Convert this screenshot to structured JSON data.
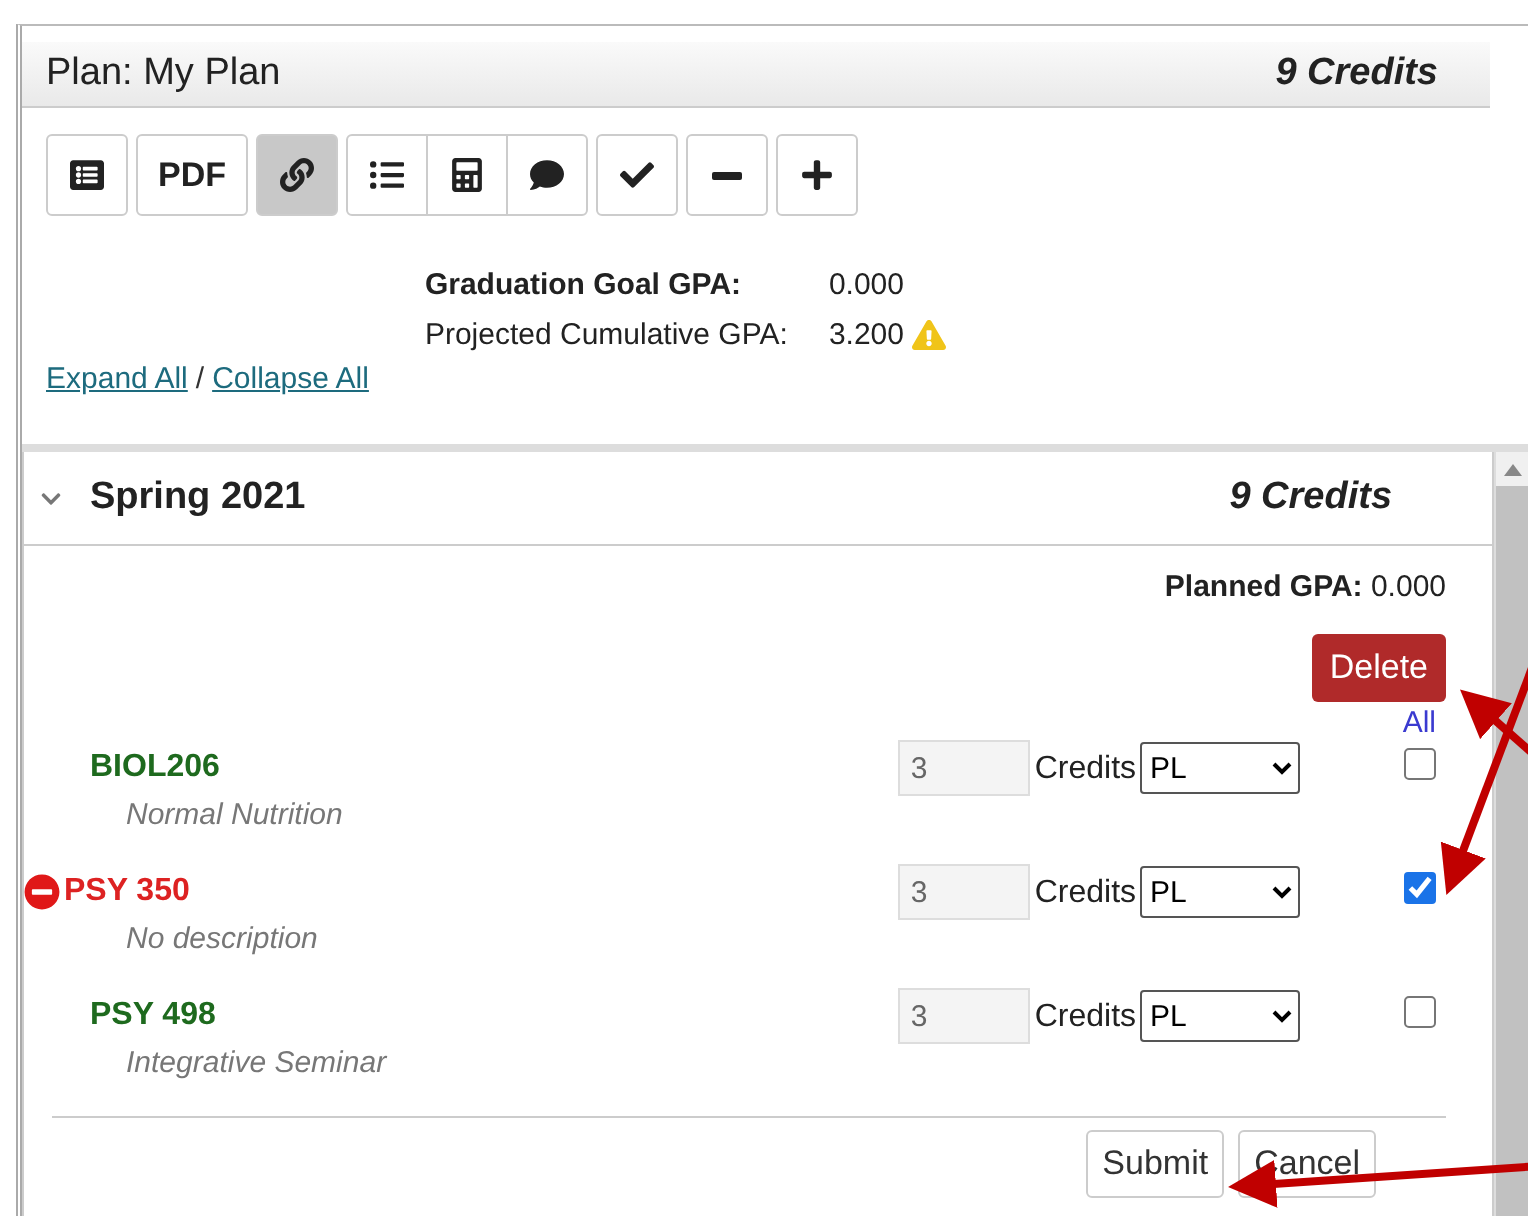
{
  "plan": {
    "title": "Plan: My Plan",
    "credits": "9 Credits"
  },
  "toolbar": {
    "groups": [
      {
        "buttons": [
          {
            "kind": "table",
            "selected": false
          }
        ]
      },
      {
        "buttons": [
          {
            "kind": "text",
            "label": "PDF",
            "selected": false
          }
        ]
      },
      {
        "buttons": [
          {
            "kind": "link",
            "selected": true
          }
        ]
      },
      {
        "buttons": [
          {
            "kind": "list",
            "selected": false
          },
          {
            "kind": "calculator",
            "selected": false
          },
          {
            "kind": "comment",
            "selected": false
          }
        ]
      },
      {
        "buttons": [
          {
            "kind": "check",
            "selected": false
          }
        ]
      },
      {
        "buttons": [
          {
            "kind": "minus",
            "selected": false
          }
        ]
      },
      {
        "buttons": [
          {
            "kind": "plus",
            "selected": false
          }
        ]
      }
    ]
  },
  "gpa": [
    {
      "label": "Graduation Goal GPA:",
      "value": "0.000",
      "bold": true,
      "warning": false
    },
    {
      "label": "Projected Cumulative GPA:",
      "value": "3.200",
      "bold": false,
      "warning": true
    }
  ],
  "links": {
    "expand": "Expand All",
    "separator": "/",
    "collapse": "Collapse All"
  },
  "term": {
    "title": "Spring 2021",
    "credits": "9 Credits",
    "expanded": true,
    "planned_gpa_label": "Planned GPA:",
    "planned_gpa": "0.000",
    "delete": "Delete",
    "all": "All",
    "courses": [
      {
        "code": "BIOL206",
        "description": "Normal Nutrition",
        "credits": "3",
        "credits_label": "Credits",
        "grade": "PL",
        "checked": false,
        "error": false
      },
      {
        "code": "PSY 350",
        "description": "No description",
        "credits": "3",
        "credits_label": "Credits",
        "grade": "PL",
        "checked": true,
        "error": true
      },
      {
        "code": "PSY 498",
        "description": "Integrative Seminar",
        "credits": "3",
        "credits_label": "Credits",
        "grade": "PL",
        "checked": false,
        "error": false
      }
    ],
    "buttons": [
      "Submit",
      "Cancel"
    ]
  }
}
